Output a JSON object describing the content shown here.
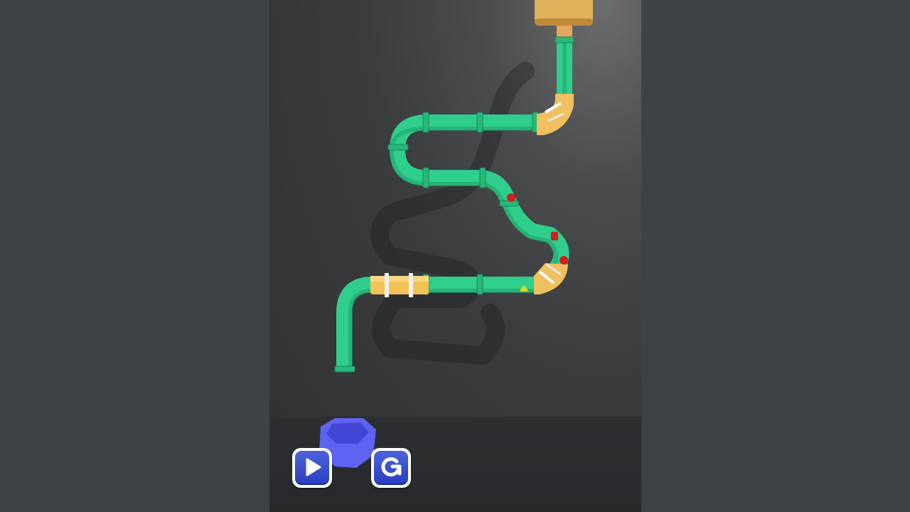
{
  "scene": {
    "background_color": "#3f4245",
    "pipe_color": "#2fce8c",
    "fixed_pipe_color": "#f0c060",
    "bucket_color": "#5f63f2",
    "ball_color": "#d81b1b"
  },
  "controls": {
    "play": {
      "icon": "play-icon"
    },
    "restart": {
      "icon": "restart-icon"
    }
  }
}
